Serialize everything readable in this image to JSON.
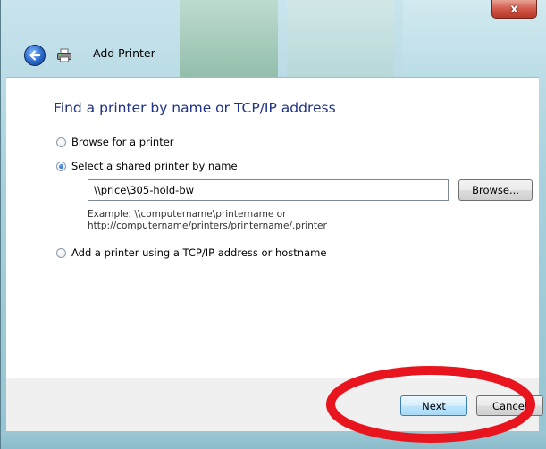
{
  "window": {
    "title": "Add Printer",
    "close_glyph": "x"
  },
  "icons": {
    "back": "back-arrow-icon",
    "printer": "printer-icon",
    "close": "close-icon"
  },
  "main": {
    "heading": "Find a printer by name or TCP/IP address",
    "options": [
      {
        "label": "Browse for a printer",
        "checked": false
      },
      {
        "label": "Select a shared printer by name",
        "checked": true
      },
      {
        "label": "Add a printer using a TCP/IP address or hostname",
        "checked": false
      }
    ],
    "printer_path_value": "\\\\price\\305-hold-bw",
    "browse_label": "Browse...",
    "example_line_1": "Example: \\\\computername\\printername or",
    "example_line_2": "http://computername/printers/printername/.printer"
  },
  "footer": {
    "next_label": "Next",
    "cancel_label": "Cancel"
  },
  "colors": {
    "heading": "#1e3287",
    "highlight_ring": "#e8141e",
    "close_button": "#c8402f"
  }
}
